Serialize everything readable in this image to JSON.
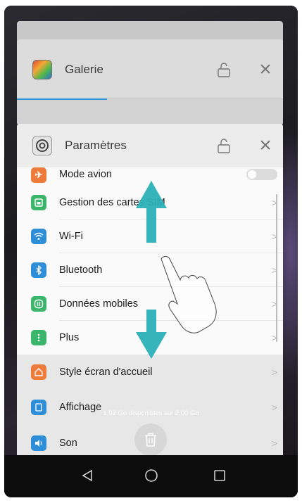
{
  "recent_apps": {
    "galerie_card": {
      "title": "Galerie"
    },
    "settings_card": {
      "title": "Paramètres",
      "items": [
        {
          "label": "Mode avion",
          "icon": "airplane-icon",
          "color": "#ef7b3a",
          "control": "toggle"
        },
        {
          "label": "Gestion des cartes SIM",
          "icon": "sim-card-icon",
          "color": "#3ab56a",
          "control": "chevron"
        },
        {
          "label": "Wi-Fi",
          "icon": "wifi-icon",
          "color": "#2e8fd8",
          "control": "chevron"
        },
        {
          "label": "Bluetooth",
          "icon": "bluetooth-icon",
          "color": "#2e8fd8",
          "control": "chevron"
        },
        {
          "label": "Données mobiles",
          "icon": "mobile-data-icon",
          "color": "#3ab56a",
          "control": "chevron"
        },
        {
          "label": "Plus",
          "icon": "more-icon",
          "color": "#3ab56a",
          "control": "chevron"
        }
      ],
      "lower_items": [
        {
          "label": "Style écran d'accueil",
          "icon": "home-style-icon",
          "color": "#ef7b3a"
        },
        {
          "label": "Affichage",
          "icon": "display-icon",
          "color": "#2e8fd8"
        },
        {
          "label": "Son",
          "icon": "sound-icon",
          "color": "#2e8fd8"
        }
      ]
    },
    "memory_text": "1,02 Go disponibles sur 2,00 Go",
    "chevron": ">"
  },
  "colors": {
    "accent_teal": "#2ab0b8",
    "accent_blue": "#2d8fd6"
  }
}
